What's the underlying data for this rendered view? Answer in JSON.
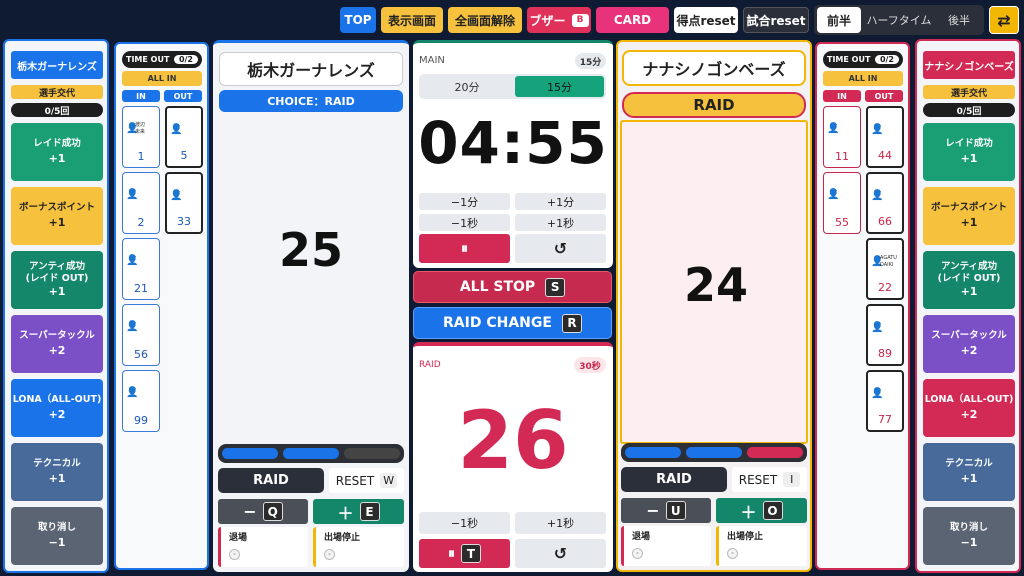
{
  "topbar": {
    "top": "TOP",
    "display": "表示画面",
    "fullscreen_exit": "全画面解除",
    "buzzer": "ブザー",
    "buzzer_key": "B",
    "card": "CARD",
    "score_reset": "得点reset",
    "match_reset": "試合reset",
    "first_half": "前半",
    "half_time": "ハーフタイム",
    "second_half": "後半",
    "swap_icon": "⇄"
  },
  "colors": {
    "blue": "#1a73e8",
    "red": "#d32a55",
    "gold": "#f2b705",
    "green": "#14866a"
  },
  "left_team": {
    "name": "栃木ガーナレンズ",
    "sub_label": "選手交代",
    "sub_count": "0/5回",
    "actions": [
      {
        "label": "レイド成功",
        "value": "+1"
      },
      {
        "label": "ボーナスポイント",
        "value": "+1"
      },
      {
        "label": "アンティ成功\n(レイド OUT)",
        "value": "+1"
      },
      {
        "label": "スーパータックル",
        "value": "+2"
      },
      {
        "label": "LONA（ALL-OUT)",
        "value": "+2"
      },
      {
        "label": "テクニカル",
        "value": "+1"
      },
      {
        "label": "取り消し",
        "value": "−1"
      }
    ],
    "timeout_label": "TIME OUT",
    "timeout_count": "0/2",
    "all_in": "ALL IN",
    "in_label": "IN",
    "out_label": "OUT",
    "in_players": [
      {
        "number": "1",
        "name": "渡辺\n未来"
      },
      {
        "number": "2",
        "name": "·"
      },
      {
        "number": "21",
        "name": "·"
      },
      {
        "number": "56",
        "name": "·"
      },
      {
        "number": "99",
        "name": "·"
      }
    ],
    "out_players": [
      {
        "number": "5",
        "name": "·"
      },
      {
        "number": "33",
        "name": "·"
      }
    ],
    "choice": "CHOICE：RAID",
    "score": "25",
    "raid_btn": "RAID",
    "reset_btn": "RESET",
    "reset_key": "W",
    "minus_key": "Q",
    "plus_key": "E",
    "minus_sym": "−",
    "plus_sym": "＋",
    "exit_label": "退場",
    "suspend_label": "出場停止",
    "placeholder": "-"
  },
  "right_team": {
    "name": "ナナシノゴンベーズ",
    "sub_label": "選手交代",
    "sub_count": "0/5回",
    "actions": [
      {
        "label": "レイド成功",
        "value": "+1"
      },
      {
        "label": "ボーナスポイント",
        "value": "+1"
      },
      {
        "label": "アンティ成功\n(レイド OUT)",
        "value": "+1"
      },
      {
        "label": "スーパータックル",
        "value": "+2"
      },
      {
        "label": "LONA（ALL-OUT)",
        "value": "+2"
      },
      {
        "label": "テクニカル",
        "value": "+1"
      },
      {
        "label": "取り消し",
        "value": "−1"
      }
    ],
    "timeout_label": "TIME OUT",
    "timeout_count": "0/2",
    "all_in": "ALL IN",
    "in_label": "IN",
    "out_label": "OUT",
    "in_players": [
      {
        "number": "11",
        "name": "·"
      },
      {
        "number": "55",
        "name": "·"
      }
    ],
    "out_players": [
      {
        "number": "44",
        "name": "·"
      },
      {
        "number": "66",
        "name": "·"
      },
      {
        "number": "22",
        "name": "AGATU\nDAIKI"
      },
      {
        "number": "89",
        "name": "·"
      },
      {
        "number": "77",
        "name": "·"
      }
    ],
    "raid_status": "RAID",
    "score": "24",
    "raid_btn": "RAID",
    "reset_btn": "RESET",
    "reset_key": "I",
    "minus_key": "U",
    "plus_key": "O",
    "minus_sym": "−",
    "plus_sym": "＋",
    "exit_label": "退場",
    "suspend_label": "出場停止",
    "placeholder": "-"
  },
  "main_timer": {
    "label": "MAIN",
    "duration_badge": "15分",
    "opt_20": "20分",
    "opt_15": "15分",
    "time": "04:55",
    "minus_min": "−1分",
    "plus_min": "+1分",
    "minus_sec": "−1秒",
    "plus_sec": "+1秒",
    "pause_icon": "⏸",
    "reset_icon": "↺"
  },
  "all_stop": "ALL STOP",
  "all_stop_key": "S",
  "raid_change": "RAID CHANGE",
  "raid_change_key": "R",
  "raid_timer": {
    "label": "RAID",
    "badge": "30秒",
    "time": "26",
    "minus_sec": "−1秒",
    "plus_sec": "+1秒",
    "pause_icon": "⏸",
    "pause_key": "T",
    "reset_icon": "↺"
  }
}
